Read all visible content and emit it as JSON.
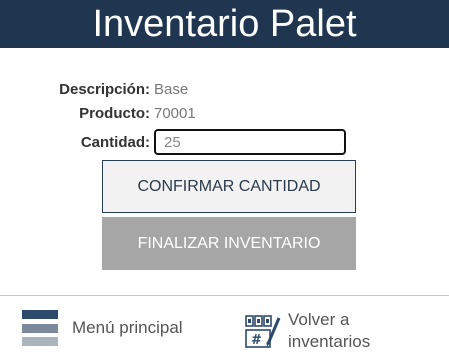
{
  "header": {
    "title": "Inventario Palet"
  },
  "info": {
    "description_label": "Descripción:",
    "description_value": "Base",
    "product_label": "Producto:",
    "product_value": "70001",
    "quantity_label": "Cantidad:",
    "quantity_value": "25"
  },
  "buttons": {
    "confirm_label": "CONFIRMAR CANTIDAD",
    "finish_label": "FINALIZAR INVENTARIO"
  },
  "footer": {
    "menu_label": "Menú principal",
    "menu_icon": "hamburger-menu-icon",
    "back_label": "Volver a inventarios",
    "back_icon": "inventory-list-icon"
  },
  "colors": {
    "header_bg": "#1f3550",
    "confirm_bg": "#f2f2f2",
    "finish_bg": "#a6a6a6"
  }
}
